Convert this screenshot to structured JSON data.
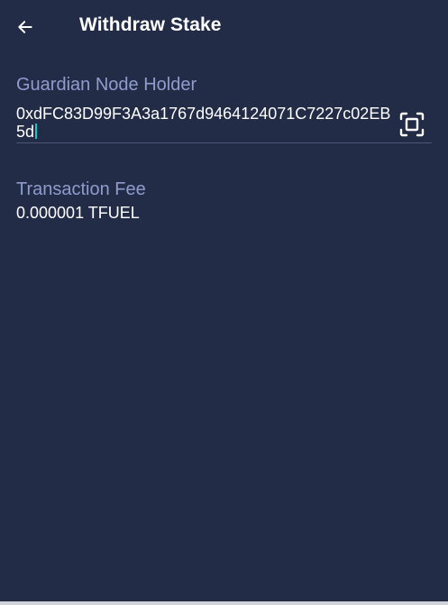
{
  "header": {
    "back_icon": "arrow-left-icon",
    "title": "Withdraw Stake"
  },
  "form": {
    "holder": {
      "label": "Guardian Node Holder",
      "value": "0xdFC83D99F3A3a1767d9464124071C7227c02EB5d",
      "scan_icon": "qr-scan-icon"
    },
    "fee": {
      "label": "Transaction Fee",
      "value": "0.000001 TFUEL"
    }
  },
  "colors": {
    "background": "#232c47",
    "label": "#8f9ccd",
    "text": "#ffffff",
    "caret": "#22c1c3",
    "underline": "#4c5677"
  }
}
